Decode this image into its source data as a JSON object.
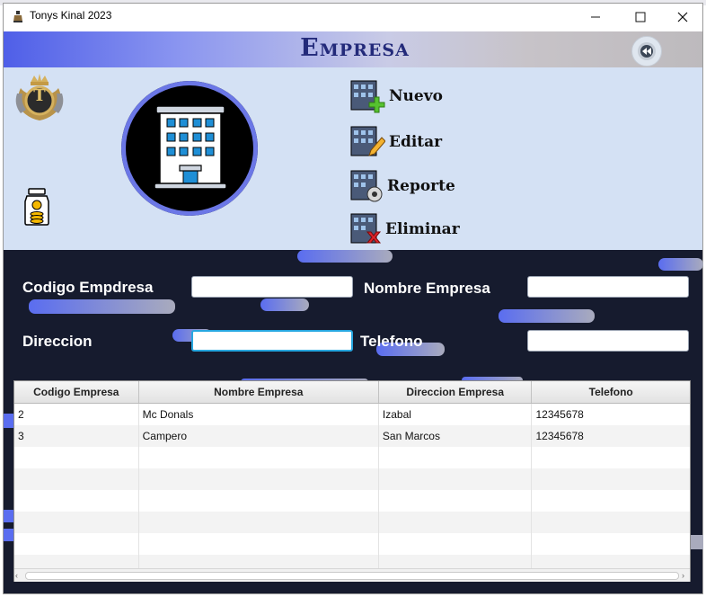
{
  "window": {
    "title": "Tonys Kinal 2023",
    "controls": [
      "minimize-icon",
      "maximize-icon",
      "close-icon"
    ]
  },
  "header": {
    "title": "Empresa",
    "back_icon": "rewind-icon"
  },
  "logo": {
    "letter": "T"
  },
  "menu": {
    "items": [
      {
        "label": "Nuevo",
        "icon": "building-add-icon"
      },
      {
        "label": "Editar",
        "icon": "building-edit-icon"
      },
      {
        "label": "Reporte",
        "icon": "building-report-icon"
      },
      {
        "label": "Eliminar",
        "icon": "building-delete-icon"
      }
    ]
  },
  "form": {
    "codigo_label": "Codigo Empdresa",
    "codigo_value": "",
    "nombre_label": "Nombre Empresa",
    "nombre_value": "",
    "direccion_label": "Direccion",
    "direccion_value": "",
    "telefono_label": "Telefono",
    "telefono_value": ""
  },
  "table": {
    "columns": [
      "Codigo Empresa",
      "Nombre Empresa",
      "Direccion Empresa",
      "Telefono"
    ],
    "rows": [
      [
        "2",
        "Mc Donals",
        "Izabal",
        "12345678"
      ],
      [
        "3",
        "Campero",
        "San Marcos",
        "12345678"
      ]
    ]
  },
  "colors": {
    "header_gradient_start": "#4f5fe8",
    "panel_bg": "#d4e1f4",
    "dark_bg": "#161b2e",
    "title_color": "#232a7a"
  }
}
